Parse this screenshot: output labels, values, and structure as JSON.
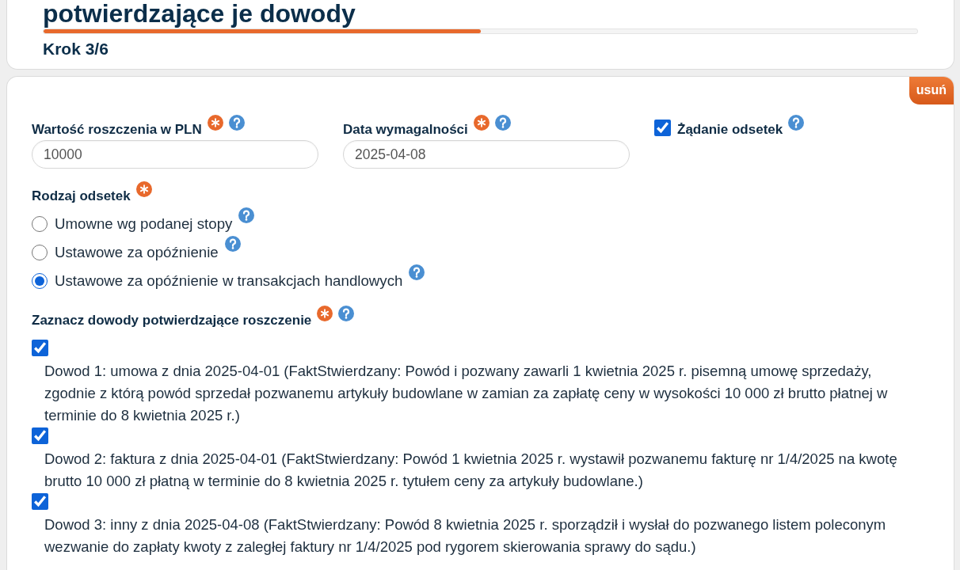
{
  "header": {
    "title": "potwierdzające je dowody",
    "progress": {
      "level": 0.5
    },
    "step": "Krok 3/6"
  },
  "form": {
    "remove_button": "usuń",
    "fields": [
      {
        "label": "Wartość roszczenia w PLN",
        "required": true,
        "help": true,
        "value": "10000"
      },
      {
        "label": "Data wymagalności",
        "required": true,
        "help": true,
        "value": "2025-04-08"
      }
    ],
    "interest_request": {
      "label": "Żądanie odsetek",
      "checked": true,
      "help": true
    },
    "interest_type": {
      "label": "Rodzaj odsetek",
      "required": true,
      "options": [
        {
          "label": "Umowne wg podanej stopy",
          "selected": false,
          "help": true
        },
        {
          "label": "Ustawowe za opóźnienie",
          "selected": false,
          "help": true
        },
        {
          "label": "Ustawowe za opóźnienie w transakcjach handlowych",
          "selected": true,
          "help": true
        }
      ]
    },
    "evidence": {
      "label": "Zaznacz dowody potwierdzające roszczenie",
      "required": true,
      "help": true,
      "items": [
        {
          "text": "Dowod 1: umowa z dnia 2025-04-01 (FaktStwierdzany: Powód i pozwany zawarli 1 kwietnia 2025 r. pisemną umowę sprzedaży, zgodnie z którą powód sprzedał pozwanemu artykuły budowlane w zamian za zapłatę ceny w wysokości 10 000 zł brutto płatnej w terminie do 8 kwietnia 2025 r.)",
          "checked": true
        },
        {
          "text": "Dowod 2: faktura z dnia 2025-04-01 (FaktStwierdzany: Powód 1 kwietnia 2025 r. wystawił pozwanemu fakturę nr 1/4/2025 na kwotę brutto 10 000 zł płatną w terminie do 8 kwietnia 2025 r. tytułem ceny za artykuły budowlane.)",
          "checked": true
        },
        {
          "text": "Dowod 3: inny z dnia 2025-04-08 (FaktStwierdzany: Powód 8 kwietnia 2025 r. sporządził i wysłał do pozwanego listem poleconym wezwanie do zapłaty kwoty z zaległej faktury nr 1/4/2025 pod rygorem skierowania sprawy do sądu.)",
          "checked": true
        }
      ]
    }
  }
}
